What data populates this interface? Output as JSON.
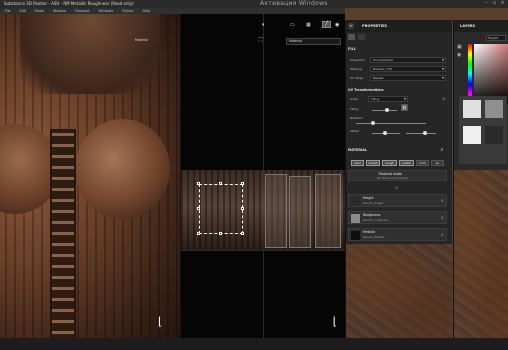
{
  "window": {
    "title": "Substance 3D Painter - ASH - RM Metallic Roughness (Read only)",
    "watermark": "Активация Windows"
  },
  "menubar": [
    "File",
    "Edit",
    "Mode",
    "Window",
    "Viewport",
    "Windows",
    "Python",
    "Help"
  ],
  "viewport3d": {
    "tab_label": "Material"
  },
  "viewport2d": {
    "dropdown": "Material"
  },
  "properties": {
    "tab_title": "PROPERTIES",
    "fill_section": "FILL",
    "projection_label": "Projection",
    "projection_value": "UV projection",
    "filtering_label": "Filtering",
    "filtering_value": "Bilinear | HQ",
    "uvwrap_label": "UV Wrap",
    "uvwrap_value": "Repeat",
    "uv_section": "UV Transformations",
    "scale_label": "Scale",
    "scale_value": "Tiling",
    "tiling_label": "Tiling",
    "rotation_label": "Rotation",
    "offset_label": "Offset",
    "material_section": "MATERIAL",
    "channels": [
      "color",
      "height",
      "rough",
      "metal",
      "nrml",
      "ao"
    ],
    "material_mode_title": "Material mode",
    "material_mode_sub": "No Resource Selected",
    "slots": [
      {
        "title": "Height",
        "sub": "Bevel1_Height"
      },
      {
        "title": "Roughness",
        "sub": "Bevel1_roughness"
      },
      {
        "title": "Metallic",
        "sub": "Bevel1_Metallic"
      }
    ]
  },
  "layers": {
    "tab_title": "LAYERS",
    "blend_dropdown": "Height"
  }
}
